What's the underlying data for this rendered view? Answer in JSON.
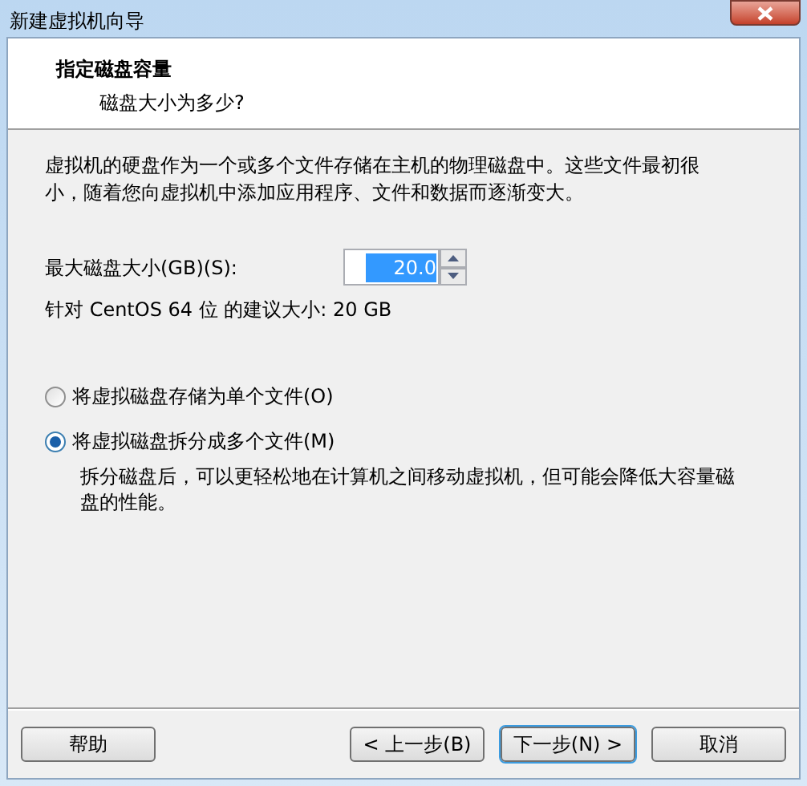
{
  "window": {
    "title": "新建虚拟机向导"
  },
  "header": {
    "title": "指定磁盘容量",
    "subtitle": "磁盘大小为多少?"
  },
  "description": "虚拟机的硬盘作为一个或多个文件存储在主机的物理磁盘中。这些文件最初很小，随着您向虚拟机中添加应用程序、文件和数据而逐渐变大。",
  "disk_size": {
    "label": "最大磁盘大小(GB)(S):",
    "value": "20.0"
  },
  "recommendation": "针对 CentOS 64 位 的建议大小: 20 GB",
  "options": [
    {
      "label": "将虚拟磁盘存储为单个文件(O)",
      "selected": false
    },
    {
      "label": "将虚拟磁盘拆分成多个文件(M)",
      "selected": true,
      "note": "拆分磁盘后，可以更轻松地在计算机之间移动虚拟机，但可能会降低大容量磁盘的性能。"
    }
  ],
  "buttons": [
    {
      "label": "帮助",
      "kind": "help"
    },
    {
      "label": "< 上一步(B)",
      "kind": "nav"
    },
    {
      "label": "下一步(N) >",
      "kind": "default"
    },
    {
      "label": "取消",
      "kind": "nav"
    }
  ]
}
